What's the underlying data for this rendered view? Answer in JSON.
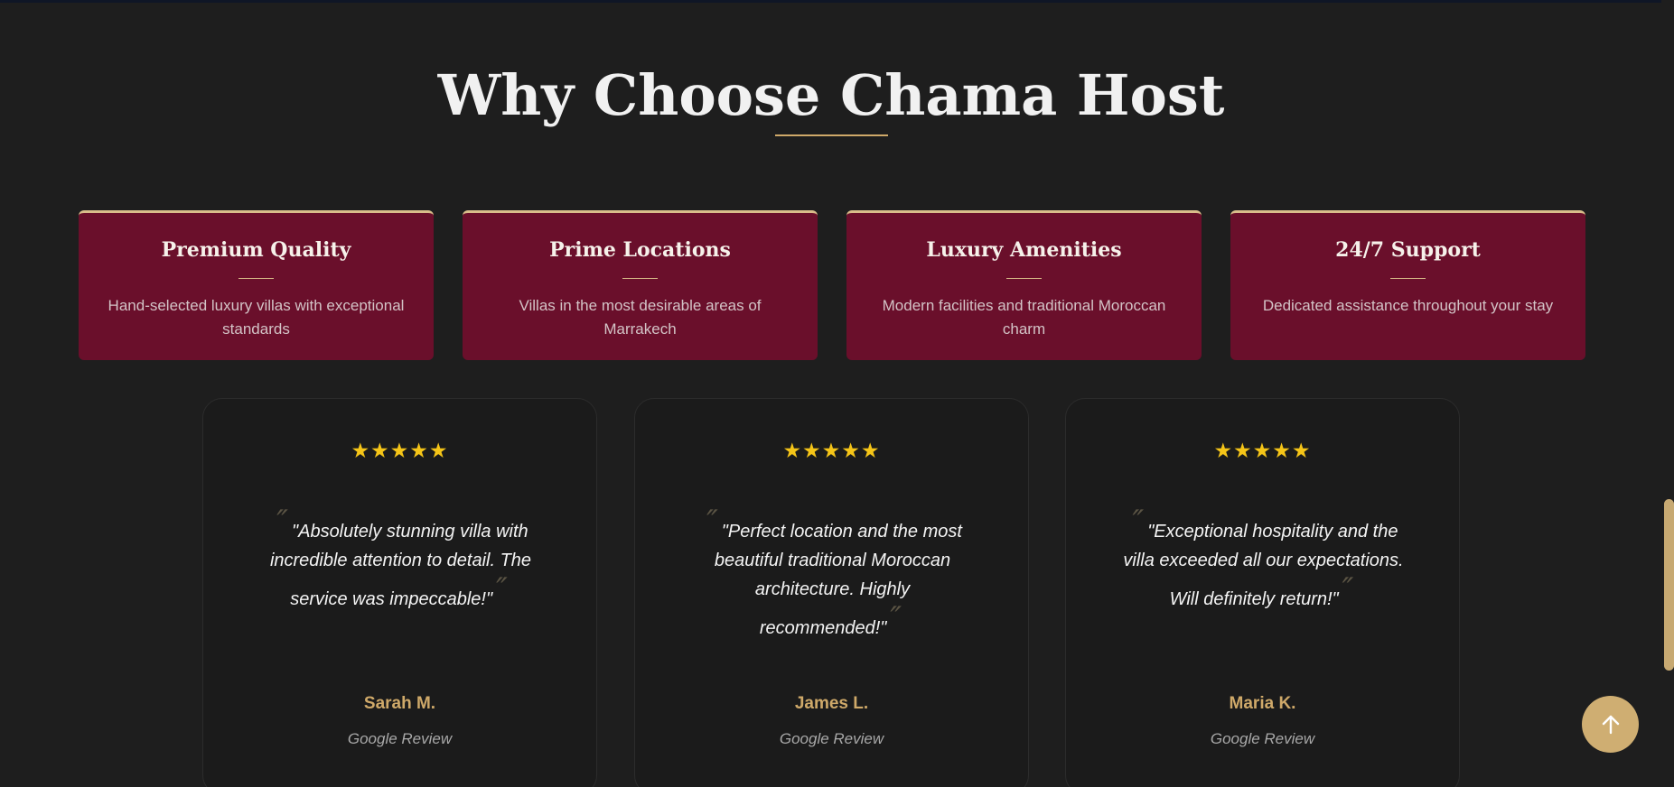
{
  "section": {
    "title": "Why Choose Chama Host"
  },
  "features": [
    {
      "title": "Premium Quality",
      "description": "Hand-selected luxury villas with exceptional standards"
    },
    {
      "title": "Prime Locations",
      "description": "Villas in the most desirable areas of Marrakech"
    },
    {
      "title": "Luxury Amenities",
      "description": "Modern facilities and traditional Moroccan charm"
    },
    {
      "title": "24/7 Support",
      "description": "Dedicated assistance throughout your stay"
    }
  ],
  "reviews": [
    {
      "stars": "★★★★★",
      "rating": 5,
      "quote": "\"Absolutely stunning villa with incredible attention to detail. The service was impeccable!\"",
      "name": "Sarah M.",
      "source": "Google Review"
    },
    {
      "stars": "★★★★★",
      "rating": 5,
      "quote": "\"Perfect location and the most beautiful traditional Moroccan architecture. Highly recommended!\"",
      "name": "James L.",
      "source": "Google Review"
    },
    {
      "stars": "★★★★★",
      "rating": 5,
      "quote": "\"Exceptional hospitality and the villa exceeded all our expectations. Will definitely return!\"",
      "name": "Maria K.",
      "source": "Google Review"
    }
  ],
  "icons": {
    "back_to_top": "arrow-up-icon",
    "quote_open": "quote-open-icon",
    "quote_close": "quote-close-icon",
    "star": "star-icon"
  },
  "colors": {
    "page_background": "#1e1e1e",
    "feature_card": "#6a0f2b",
    "accent_gold": "#cfa969",
    "star": "#f5c518",
    "review_card": "#1b1b1b"
  }
}
